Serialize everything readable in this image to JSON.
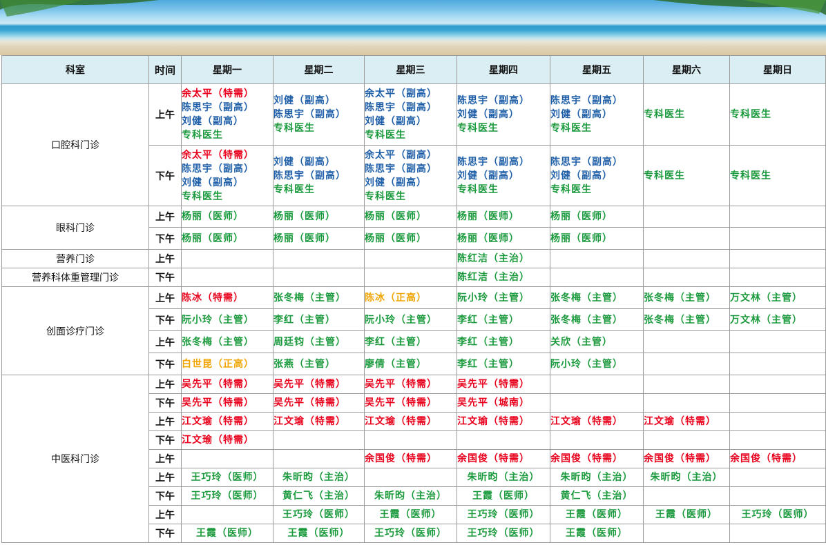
{
  "colors": {
    "red": "#e8001c",
    "blue": "#1f5fa8",
    "green": "#1a9a3c",
    "gold": "#f0a500",
    "header_bg": "#dbeef3"
  },
  "header": {
    "dept": "科室",
    "time": "时间",
    "days": [
      "星期一",
      "星期二",
      "星期三",
      "星期四",
      "星期五",
      "星期六",
      "星期日"
    ]
  },
  "rows": [
    {
      "dept": "口腔科门诊",
      "slot": "上午",
      "cells": [
        [
          [
            "red",
            "余太平（特需）"
          ],
          [
            "blue",
            "陈思宇（副高）"
          ],
          [
            "blue",
            "刘健（副高）"
          ],
          [
            "green",
            "专科医生"
          ]
        ],
        [
          [
            "blue",
            "刘健（副高）"
          ],
          [
            "blue",
            "陈思宇（副高）"
          ],
          [
            "green",
            "专科医生"
          ]
        ],
        [
          [
            "blue",
            "余太平（副高）"
          ],
          [
            "blue",
            "陈思宇（副高）"
          ],
          [
            "blue",
            "刘健（副高）"
          ],
          [
            "green",
            "专科医生"
          ]
        ],
        [
          [
            "blue",
            "陈思宇（副高）"
          ],
          [
            "blue",
            "刘健（副高）"
          ],
          [
            "green",
            "专科医生"
          ]
        ],
        [
          [
            "blue",
            "陈思宇（副高）"
          ],
          [
            "blue",
            "刘健（副高）"
          ],
          [
            "green",
            "专科医生"
          ]
        ],
        [
          [
            "green",
            "专科医生"
          ]
        ],
        [
          [
            "green",
            "专科医生"
          ]
        ]
      ]
    },
    {
      "dept": "",
      "slot": "下午",
      "cells": [
        [
          [
            "red",
            "余太平（特需）"
          ],
          [
            "blue",
            "陈思宇（副高）"
          ],
          [
            "blue",
            "刘健（副高）"
          ],
          [
            "green",
            "专科医生"
          ]
        ],
        [
          [
            "blue",
            "刘健（副高）"
          ],
          [
            "blue",
            "陈思宇（副高）"
          ],
          [
            "green",
            "专科医生"
          ]
        ],
        [
          [
            "blue",
            "余太平（副高）"
          ],
          [
            "blue",
            "陈思宇（副高）"
          ],
          [
            "blue",
            "刘健（副高）"
          ],
          [
            "green",
            "专科医生"
          ]
        ],
        [
          [
            "blue",
            "陈思宇（副高）"
          ],
          [
            "blue",
            "刘健（副高）"
          ],
          [
            "green",
            "专科医生"
          ]
        ],
        [
          [
            "blue",
            "陈思宇（副高）"
          ],
          [
            "blue",
            "刘健（副高）"
          ],
          [
            "green",
            "专科医生"
          ]
        ],
        [
          [
            "green",
            "专科医生"
          ]
        ],
        [
          [
            "green",
            "专科医生"
          ]
        ]
      ]
    },
    {
      "dept": "眼科门诊",
      "slot": "上午",
      "cells": [
        [
          [
            "green",
            "杨丽（医师）"
          ]
        ],
        [
          [
            "green",
            "杨丽（医师）"
          ]
        ],
        [
          [
            "green",
            "杨丽（医师）"
          ]
        ],
        [
          [
            "green",
            "杨丽（医师）"
          ]
        ],
        [
          [
            "green",
            "杨丽（医师）"
          ]
        ],
        [],
        []
      ]
    },
    {
      "dept": "",
      "slot": "下午",
      "cells": [
        [
          [
            "green",
            "杨丽（医师）"
          ]
        ],
        [
          [
            "green",
            "杨丽（医师）"
          ]
        ],
        [
          [
            "green",
            "杨丽（医师）"
          ]
        ],
        [
          [
            "green",
            "杨丽（医师）"
          ]
        ],
        [
          [
            "green",
            "杨丽（医师）"
          ]
        ],
        [],
        []
      ]
    },
    {
      "dept": "营养门诊",
      "slot": "上午",
      "cells": [
        [],
        [],
        [],
        [
          [
            "green",
            "陈红洁（主治）"
          ]
        ],
        [],
        [],
        []
      ]
    },
    {
      "dept": "营养科体重管理门诊",
      "slot": "下午",
      "cells": [
        [],
        [],
        [],
        [
          [
            "green",
            "陈红洁（主治）"
          ]
        ],
        [],
        [],
        []
      ]
    },
    {
      "dept": "创面诊疗门诊",
      "slot": "上午",
      "cells": [
        [
          [
            "red",
            "陈冰（特需）"
          ]
        ],
        [
          [
            "green",
            "张冬梅（主管）"
          ]
        ],
        [
          [
            "gold",
            "陈冰（正高）"
          ]
        ],
        [
          [
            "green",
            "阮小玲（主管）"
          ]
        ],
        [
          [
            "green",
            "张冬梅（主管）"
          ]
        ],
        [
          [
            "green",
            "张冬梅（主管）"
          ]
        ],
        [
          [
            "green",
            "万文林（主管）"
          ]
        ]
      ]
    },
    {
      "dept": "",
      "slot": "下午",
      "cells": [
        [
          [
            "green",
            "阮小玲（主管）"
          ]
        ],
        [
          [
            "green",
            "李红（主管）"
          ]
        ],
        [
          [
            "green",
            "阮小玲（主管）"
          ]
        ],
        [
          [
            "green",
            "李红（主管）"
          ]
        ],
        [
          [
            "green",
            "张冬梅（主管）"
          ]
        ],
        [
          [
            "green",
            "张冬梅（主管）"
          ]
        ],
        [
          [
            "green",
            "万文林（主管）"
          ]
        ]
      ]
    },
    {
      "dept": "",
      "slot": "上午",
      "cells": [
        [
          [
            "green",
            "张冬梅（主管）"
          ]
        ],
        [
          [
            "green",
            "周廷钧（主管）"
          ]
        ],
        [
          [
            "green",
            "李红（主管）"
          ]
        ],
        [
          [
            "green",
            "李红（主管）"
          ]
        ],
        [
          [
            "green",
            "关欣（主管）"
          ]
        ],
        [],
        []
      ]
    },
    {
      "dept": "",
      "slot": "下午",
      "cells": [
        [
          [
            "gold",
            "白世昆（正高）"
          ]
        ],
        [
          [
            "green",
            "张燕（主管）"
          ]
        ],
        [
          [
            "green",
            "廖倩（主管）"
          ]
        ],
        [
          [
            "green",
            "李红（主管）"
          ]
        ],
        [
          [
            "green",
            "阮小玲（主管）"
          ]
        ],
        [],
        []
      ]
    },
    {
      "dept": "中医科门诊",
      "slot": "上午",
      "cells": [
        [
          [
            "red",
            "吴先平（特需）"
          ]
        ],
        [
          [
            "red",
            "吴先平（特需）"
          ]
        ],
        [
          [
            "red",
            "吴先平（特需）"
          ]
        ],
        [
          [
            "red",
            "吴先平（特需）"
          ]
        ],
        [],
        [],
        []
      ]
    },
    {
      "dept": "",
      "slot": "下午",
      "cells": [
        [
          [
            "red",
            "吴先平（特需）"
          ]
        ],
        [
          [
            "red",
            "吴先平（特需）"
          ]
        ],
        [
          [
            "red",
            "吴先平（特需）"
          ]
        ],
        [
          [
            "red",
            "吴先平（城南）"
          ]
        ],
        [],
        [],
        []
      ]
    },
    {
      "dept": "",
      "slot": "上午",
      "cells": [
        [
          [
            "red",
            "江文瑜（特需）"
          ]
        ],
        [
          [
            "red",
            "江文瑜（特需）"
          ]
        ],
        [
          [
            "red",
            "江文瑜（特需）"
          ]
        ],
        [
          [
            "red",
            "江文瑜（特需）"
          ]
        ],
        [
          [
            "red",
            "江文瑜（特需）"
          ]
        ],
        [
          [
            "red",
            "江文瑜（特需）"
          ]
        ],
        []
      ]
    },
    {
      "dept": "",
      "slot": "下午",
      "cells": [
        [
          [
            "red",
            "江文瑜（特需）"
          ]
        ],
        [],
        [],
        [],
        [],
        [],
        []
      ]
    },
    {
      "dept": "",
      "slot": "上午",
      "cells": [
        [],
        [],
        [
          [
            "red",
            "余国俊（特需）"
          ]
        ],
        [
          [
            "red",
            "余国俊（特需）"
          ]
        ],
        [
          [
            "red",
            "余国俊（特需）"
          ]
        ],
        [
          [
            "red",
            "余国俊（特需）"
          ]
        ],
        [
          [
            "red",
            "余国俊（特需）"
          ]
        ]
      ]
    },
    {
      "dept": "",
      "slot": "上午",
      "center": true,
      "cells": [
        [
          [
            "green",
            "王巧玲（医师）"
          ]
        ],
        [
          [
            "green",
            "朱昕昀（主治）"
          ]
        ],
        [],
        [
          [
            "green",
            "朱昕昀（主治）"
          ]
        ],
        [
          [
            "green",
            "朱昕昀（主治）"
          ]
        ],
        [
          [
            "green",
            "朱昕昀（主治）"
          ]
        ],
        []
      ]
    },
    {
      "dept": "",
      "slot": "下午",
      "center": true,
      "cells": [
        [
          [
            "green",
            "王巧玲（医师）"
          ]
        ],
        [
          [
            "green",
            "黄仁飞（主治）"
          ]
        ],
        [
          [
            "green",
            "朱昕昀（主治）"
          ]
        ],
        [
          [
            "green",
            "王霞（医师）"
          ]
        ],
        [
          [
            "green",
            "黄仁飞（主治）"
          ]
        ],
        [],
        []
      ]
    },
    {
      "dept": "",
      "slot": "上午",
      "center": true,
      "cells": [
        [],
        [
          [
            "green",
            "王巧玲（医师）"
          ]
        ],
        [
          [
            "green",
            "王霞（医师）"
          ]
        ],
        [
          [
            "green",
            "王巧玲（医师）"
          ]
        ],
        [
          [
            "green",
            "王霞（医师）"
          ]
        ],
        [
          [
            "green",
            "王霞（医师）"
          ]
        ],
        [
          [
            "green",
            "王巧玲（医师）"
          ]
        ]
      ]
    },
    {
      "dept": "",
      "slot": "下午",
      "center": true,
      "cells": [
        [
          [
            "green",
            "王霞（医师）"
          ]
        ],
        [
          [
            "green",
            "王霞（医师）"
          ]
        ],
        [
          [
            "green",
            "王巧玲（医师）"
          ]
        ],
        [
          [
            "green",
            "王巧玲（医师）"
          ]
        ],
        [
          [
            "green",
            "王霞（医师）"
          ]
        ],
        [],
        []
      ]
    }
  ]
}
